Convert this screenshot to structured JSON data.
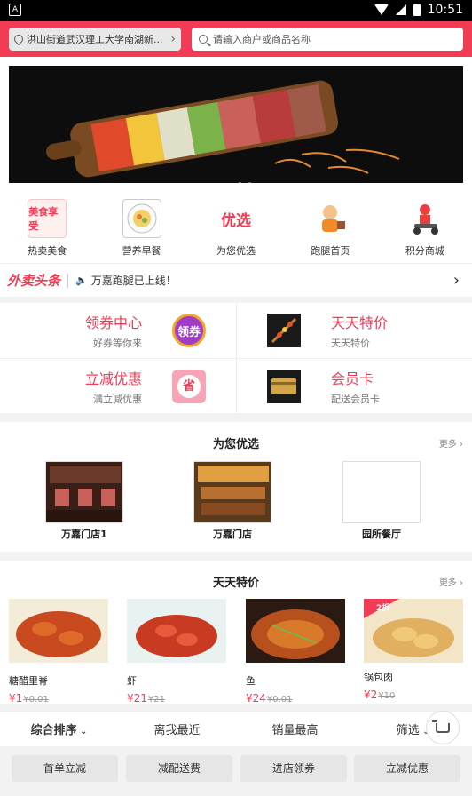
{
  "statusbar": {
    "time": "10:51",
    "left_icon": "A"
  },
  "header": {
    "location": "洪山街道武汉理工大学南湖新...",
    "search_placeholder": "请输入商户或商品名称"
  },
  "categories": [
    {
      "label": "热卖美食",
      "icon_text": "美食享受",
      "icon": "food-poster-icon",
      "color": "#f23b55"
    },
    {
      "label": "营养早餐",
      "icon_text": "",
      "icon": "breakfast-plate-icon",
      "color": "#f5d067"
    },
    {
      "label": "为您优选",
      "icon_text": "优选",
      "icon": "youxuan-icon",
      "color": "#f23b55"
    },
    {
      "label": "跑腿首页",
      "icon_text": "",
      "icon": "delivery-person-icon",
      "color": "#f28a2a"
    },
    {
      "label": "积分商城",
      "icon_text": "",
      "icon": "scooter-rider-icon",
      "color": "#e84040"
    }
  ],
  "news": {
    "logo": "外卖头条",
    "text": "万嘉跑腿已上线！"
  },
  "promos": [
    {
      "title": "领券中心",
      "sub": "好券等你来",
      "icon": "coupon-icon",
      "icon_text": "领券"
    },
    {
      "title": "天天特价",
      "sub": "天天特价",
      "icon": "skewer-food-icon",
      "icon_text": ""
    },
    {
      "title": "立减优惠",
      "sub": "满立减优惠",
      "icon": "discount-icon",
      "icon_text": "省"
    },
    {
      "title": "会员卡",
      "sub": "配送会员卡",
      "icon": "membership-card-icon",
      "icon_text": ""
    }
  ],
  "recommend": {
    "title": "为您优选",
    "more": "更多",
    "shops": [
      {
        "name": "万嘉门店1"
      },
      {
        "name": "万嘉门店"
      },
      {
        "name": "园所餐厅"
      }
    ]
  },
  "deals": {
    "title": "天天特价",
    "more": "更多",
    "items": [
      {
        "name": "糖醋里脊",
        "price": "¥1",
        "old_price": "¥0.01",
        "badge": ""
      },
      {
        "name": "虾",
        "price": "¥21",
        "old_price": "¥21",
        "badge": ""
      },
      {
        "name": "鱼",
        "price": "¥24",
        "old_price": "¥0.01",
        "badge": ""
      },
      {
        "name": "锅包肉",
        "price": "¥2",
        "old_price": "¥10",
        "badge": "2折"
      }
    ]
  },
  "sort": [
    {
      "label": "综合排序"
    },
    {
      "label": "离我最近"
    },
    {
      "label": "销量最高"
    },
    {
      "label": "筛选"
    }
  ],
  "filters": [
    {
      "label": "首单立减"
    },
    {
      "label": "减配送费"
    },
    {
      "label": "进店领券"
    },
    {
      "label": "立减优惠"
    }
  ],
  "colors": {
    "accent": "#f23b55"
  }
}
